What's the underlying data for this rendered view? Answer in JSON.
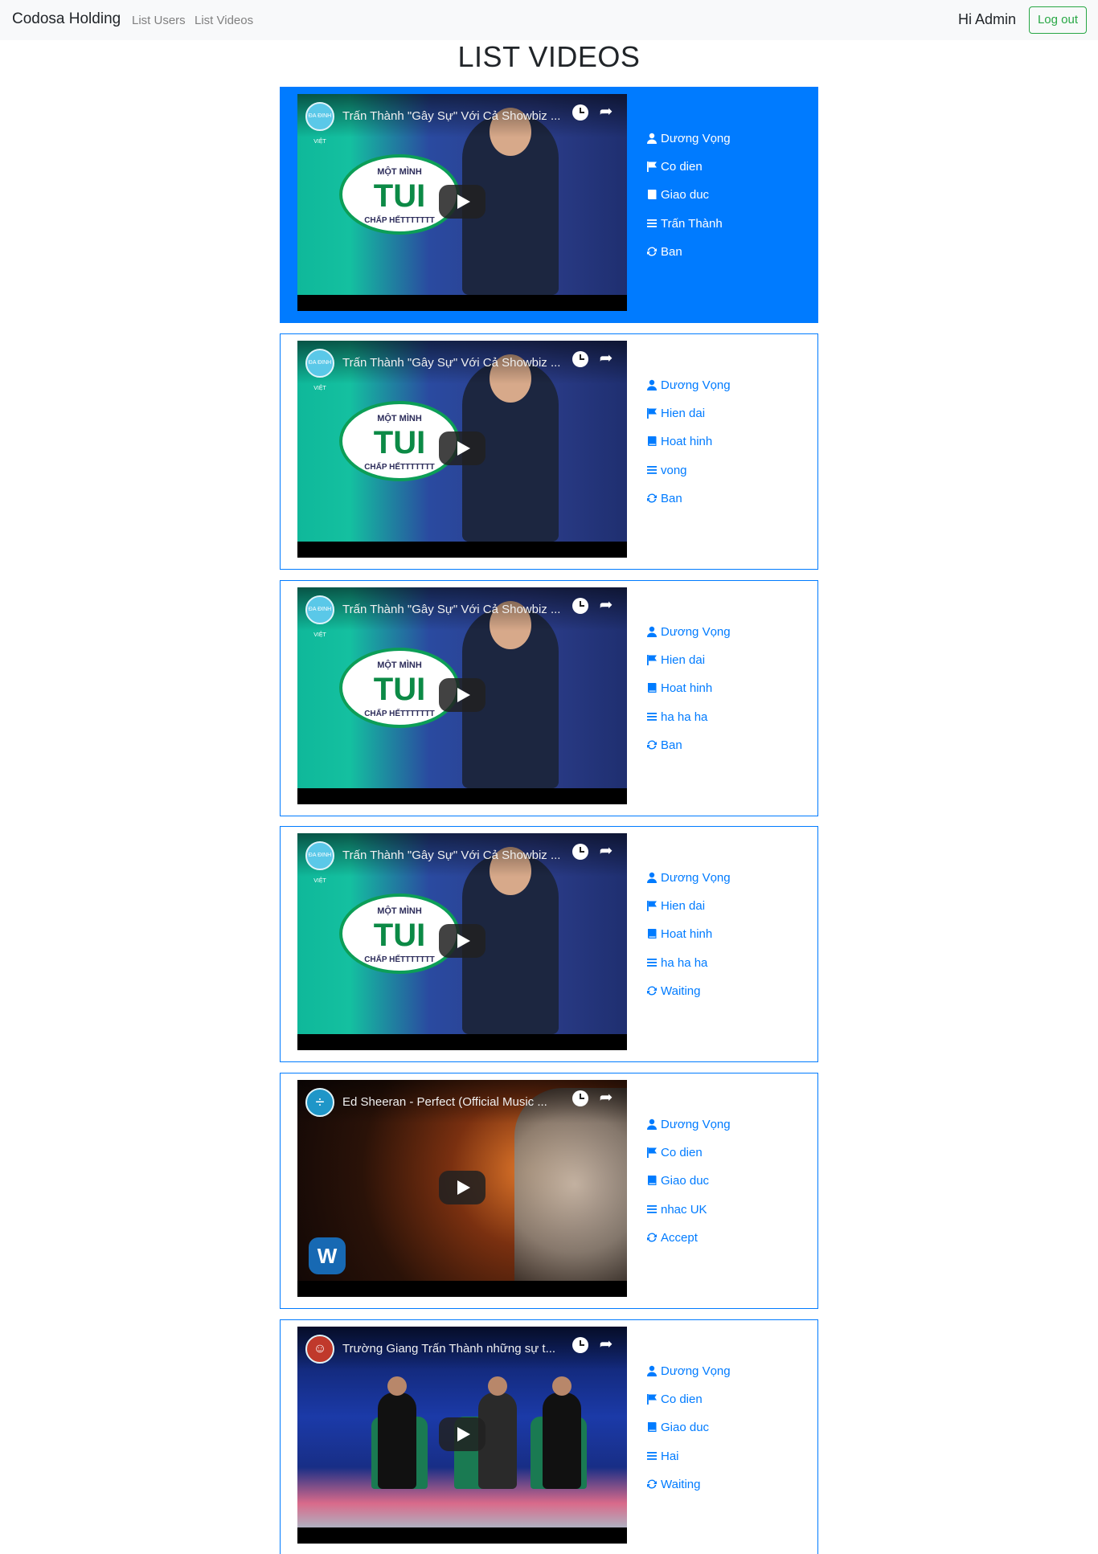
{
  "navbar": {
    "brand": "Codosa Holding",
    "links": [
      "List Users",
      "List Videos"
    ],
    "greeting": "Hi Admin",
    "logout_label": "Log out"
  },
  "page": {
    "title": "LIST VIDEOS"
  },
  "colors": {
    "accent": "#007bff",
    "logout": "#28a745",
    "navbar_bg": "#f8f9fa"
  },
  "videos": [
    {
      "title": "Trấn Thành \"Gây Sự\" Với Cả Showbiz ...",
      "thumbnail": "tran-thanh",
      "channel_label": "ĐA ĐINH VIỆT",
      "author": "Dương Vọng",
      "style": "Co dien",
      "category": "Giao duc",
      "description": "Trấn Thành",
      "status": "Ban",
      "selected": true
    },
    {
      "title": "Trấn Thành \"Gây Sự\" Với Cả Showbiz ...",
      "thumbnail": "tran-thanh",
      "channel_label": "ĐA ĐINH VIỆT",
      "author": "Dương Vọng",
      "style": "Hien dai",
      "category": "Hoat hinh",
      "description": "vong",
      "status": "Ban",
      "selected": false
    },
    {
      "title": "Trấn Thành \"Gây Sự\" Với Cả Showbiz ...",
      "thumbnail": "tran-thanh",
      "channel_label": "ĐA ĐINH VIỆT",
      "author": "Dương Vọng",
      "style": "Hien dai",
      "category": "Hoat hinh",
      "description": "ha ha ha",
      "status": "Ban",
      "selected": false
    },
    {
      "title": "Trấn Thành \"Gây Sự\" Với Cả Showbiz ...",
      "thumbnail": "tran-thanh",
      "channel_label": "ĐA ĐINH VIỆT",
      "author": "Dương Vọng",
      "style": "Hien dai",
      "category": "Hoat hinh",
      "description": "ha ha ha",
      "status": "Waiting",
      "selected": false
    },
    {
      "title": "Ed Sheeran - Perfect (Official Music ...",
      "thumbnail": "ed-sheeran",
      "channel_label": "÷",
      "author": "Dương Vọng",
      "style": "Co dien",
      "category": "Giao duc",
      "description": "nhac UK",
      "status": "Accept",
      "selected": false
    },
    {
      "title": "Trường Giang Trấn Thành những sự t...",
      "thumbnail": "stage",
      "channel_label": "☺",
      "author": "Dương Vọng",
      "style": "Co dien",
      "category": "Giao duc",
      "description": "Hai",
      "status": "Waiting",
      "selected": false
    }
  ],
  "meta_icons": [
    "user-icon",
    "flag-icon",
    "book-icon",
    "list-icon",
    "refresh-icon"
  ]
}
